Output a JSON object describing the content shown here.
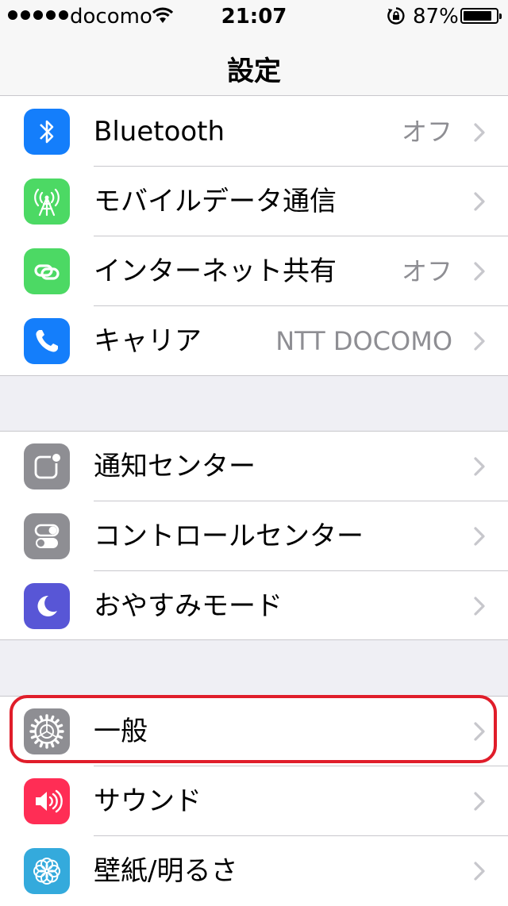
{
  "status_bar": {
    "carrier": "docomo",
    "time": "21:07",
    "battery_percent": "87%",
    "battery_level": 0.87,
    "signal_dots": 5
  },
  "nav": {
    "title": "設定"
  },
  "groups": [
    {
      "rows": [
        {
          "label": "Bluetooth",
          "value": "オフ",
          "icon": "bluetooth-icon",
          "icon_color": "#147efb"
        },
        {
          "label": "モバイルデータ通信",
          "value": "",
          "icon": "cellular-antenna-icon",
          "icon_color": "#4cd964"
        },
        {
          "label": "インターネット共有",
          "value": "オフ",
          "icon": "chain-link-icon",
          "icon_color": "#4cd964"
        },
        {
          "label": "キャリア",
          "value": "NTT DOCOMO",
          "icon": "phone-icon",
          "icon_color": "#147efb"
        }
      ]
    },
    {
      "rows": [
        {
          "label": "通知センター",
          "value": "",
          "icon": "notification-center-icon",
          "icon_color": "#8e8e93"
        },
        {
          "label": "コントロールセンター",
          "value": "",
          "icon": "control-center-toggles-icon",
          "icon_color": "#8e8e93"
        },
        {
          "label": "おやすみモード",
          "value": "",
          "icon": "moon-icon",
          "icon_color": "#5856d6"
        }
      ]
    },
    {
      "rows": [
        {
          "label": "一般",
          "value": "",
          "icon": "gear-icon",
          "icon_color": "#8e8e93"
        },
        {
          "label": "サウンド",
          "value": "",
          "icon": "speaker-icon",
          "icon_color": "#ff2d55"
        },
        {
          "label": "壁紙/明るさ",
          "value": "",
          "icon": "flower-icon",
          "icon_color": "#34aadc"
        }
      ]
    }
  ],
  "highlight_color": "#e01d2a"
}
